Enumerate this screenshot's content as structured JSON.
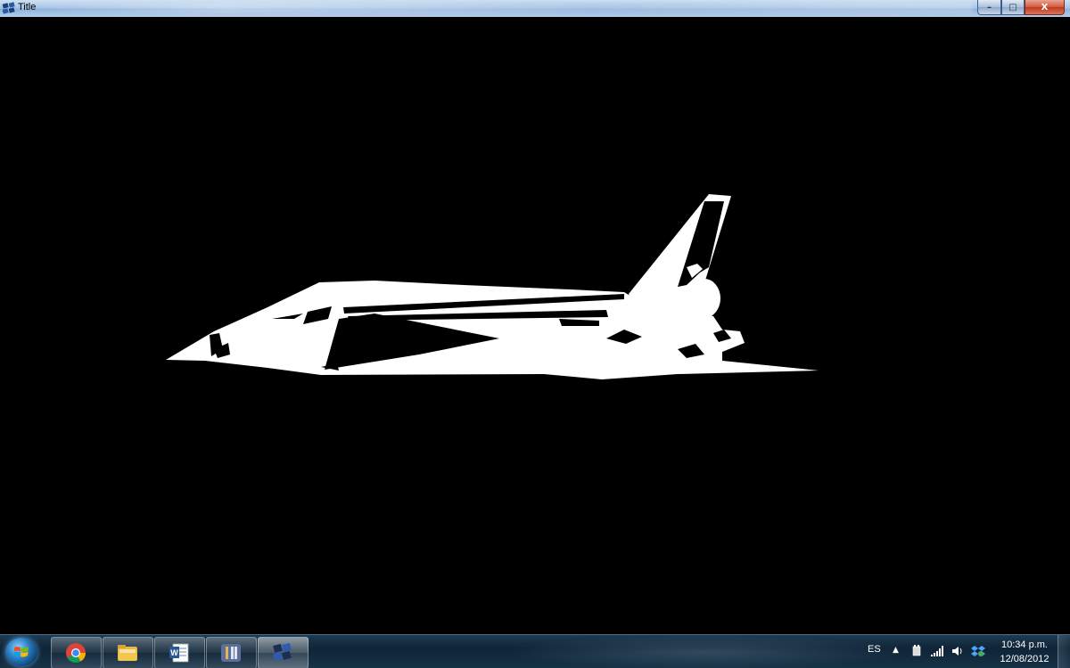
{
  "window": {
    "title": "Title",
    "controls": {
      "minimize": "–",
      "maximize": "□",
      "close": "X"
    }
  },
  "scene": {
    "description_icon": "space-shuttle-model",
    "fill_color": "#ffffff",
    "background_color": "#000000"
  },
  "taskbar": {
    "start_icon": "windows-start-orb",
    "items": [
      {
        "name": "chrome",
        "icon": "chrome-icon"
      },
      {
        "name": "file-explorer",
        "icon": "folder-icon"
      },
      {
        "name": "word",
        "icon": "word-icon"
      },
      {
        "name": "intellij",
        "icon": "intellij-icon"
      },
      {
        "name": "opengl-app",
        "icon": "app-window-icon",
        "active": true
      }
    ],
    "tray": {
      "language": "ES",
      "time": "10:34 p.m.",
      "date": "12/08/2012"
    }
  }
}
